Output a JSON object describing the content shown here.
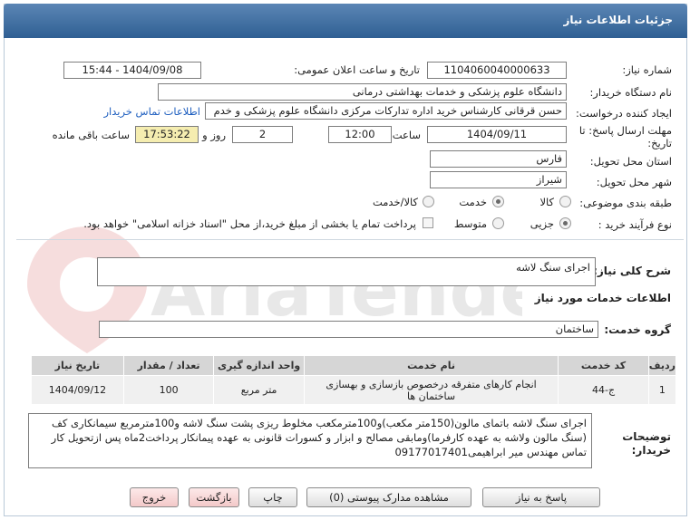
{
  "header": {
    "title": "جزئیات اطلاعات نیاز"
  },
  "form": {
    "need_number_label": "شماره نیاز:",
    "need_number": "1104060040000633",
    "announce_label": "تاریخ و ساعت اعلان عمومی:",
    "announce_value": "1404/09/08 - 15:44",
    "buyer_org_label": "نام دستگاه خریدار:",
    "buyer_org": "دانشگاه علوم پزشکی و خدمات بهداشتی درمانی",
    "creator_label": "ایجاد کننده درخواست:",
    "creator": "حسن قرقانی کارشناس خرید اداره تدارکات مرکزی دانشگاه علوم پزشکی و خدم",
    "contact_link": "اطلاعات تماس خریدار",
    "deadline_label_1": "مهلت ارسال پاسخ: تا",
    "deadline_label_2": "تاریخ:",
    "deadline_date": "1404/09/11",
    "time_label": "ساعت",
    "deadline_time": "12:00",
    "days_value": "2",
    "days_label": "روز و",
    "remaining_time": "17:53:22",
    "remaining_label": "ساعت باقی مانده",
    "province_label": "استان محل تحویل:",
    "province": "فارس",
    "city_label": "شهر محل تحویل:",
    "city": "شیراز",
    "category_label": "طبقه بندی موضوعی:",
    "category_options": [
      "کالا",
      "خدمت",
      "کالا/خدمت"
    ],
    "category_selected": "خدمت",
    "process_label": "نوع فرآیند خرید :",
    "process_options": [
      "جزیی",
      "متوسط"
    ],
    "process_selected": "جزیی",
    "payment_note": "پرداخت تمام یا بخشی از مبلغ خرید،از محل \"اسناد خزانه اسلامی\" خواهد بود."
  },
  "summary": {
    "label": "شرح کلی نیاز:",
    "value": "اجرای سنگ لاشه"
  },
  "services": {
    "section_title": "اطلاعات خدمات مورد نیاز",
    "group_label": "گروه خدمت:",
    "group_value": "ساختمان"
  },
  "table": {
    "headers": [
      "ردیف",
      "کد خدمت",
      "نام خدمت",
      "واحد اندازه گیری",
      "تعداد / مقدار",
      "تاریخ نیاز"
    ],
    "rows": [
      [
        "1",
        "ج-44",
        "انجام کارهای متفرقه درخصوص بازسازی و بهسازی ساختمان ها",
        "متر مربع",
        "100",
        "1404/09/12"
      ]
    ]
  },
  "buyer_notes": {
    "label_1": "توضیحات",
    "label_2": "خریدار:",
    "text": "اجرای سنگ لاشه باتمای مالون(150متر مکعب)و100مترمکعب مخلوط ریزی پشت سنگ لاشه و100مترمربع سیمانکاری کف (سنگ مالون ولاشه به عهده کارفرما)ومابقی مصالح و ابزار و کسورات قانونی به عهده پیمانکار پرداخت2ماه پس ازتحویل کار تماس مهندس میر ابراهیمی09177017401"
  },
  "buttons": {
    "reply": "پاسخ به نیاز",
    "attachments": "مشاهده مدارک پیوستی (0)",
    "print": "چاپ",
    "back": "بازگشت",
    "exit": "خروج"
  },
  "watermark": {
    "text": "AriaTender.net"
  },
  "colors": {
    "title_bar": "#2f5f93",
    "link": "#1f5fbf",
    "remaining_bg": "#f5edb0"
  }
}
